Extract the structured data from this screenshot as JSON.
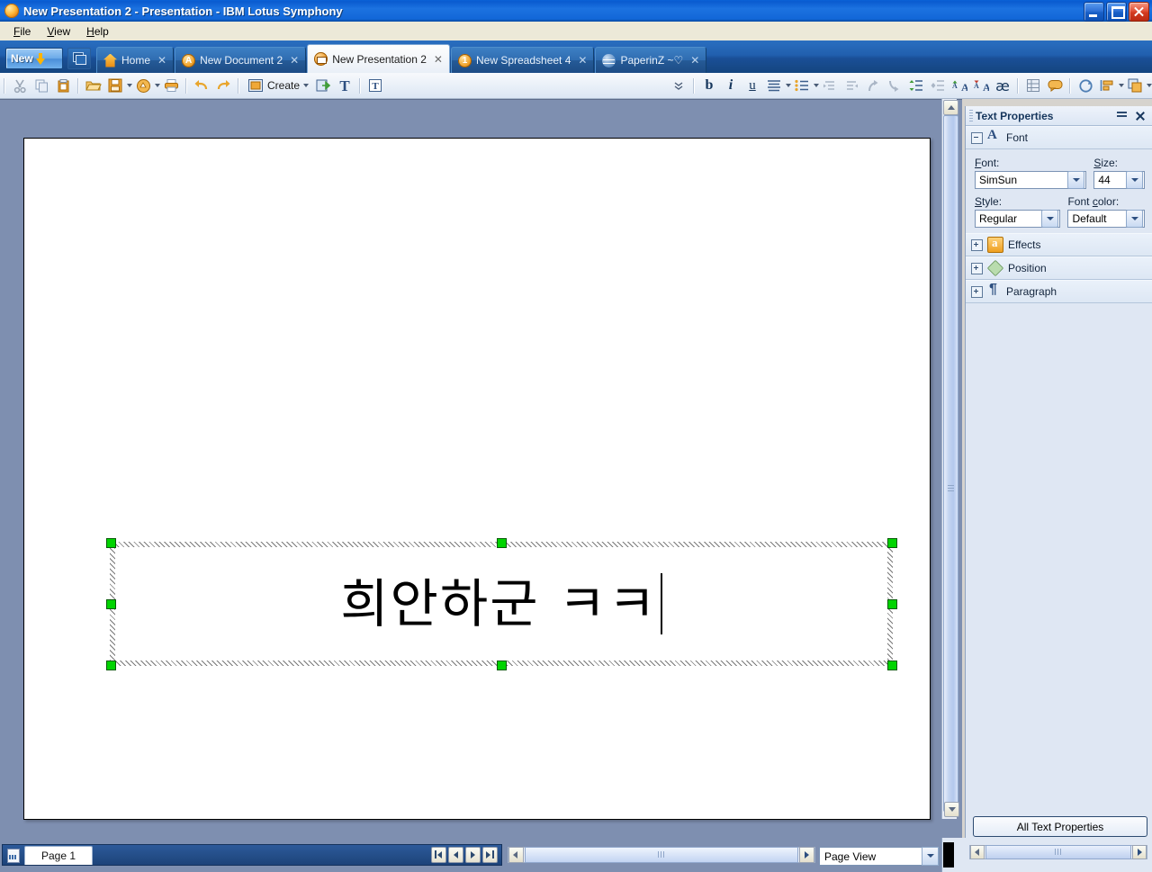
{
  "window": {
    "title": "New Presentation 2 - Presentation - IBM Lotus Symphony",
    "app_icon": "symphony-orb-icon",
    "buttons": {
      "minimize": "minimize-button",
      "restore": "restore-button",
      "close": "close-button"
    }
  },
  "menubar": {
    "items": [
      "File",
      "View",
      "Help"
    ]
  },
  "tabbar": {
    "new_button": {
      "label": "New",
      "icon": "download-arrow-icon"
    },
    "window_list_icon": "window-list-icon",
    "tabs": [
      {
        "label": "Home",
        "icon": "home-icon",
        "active": false,
        "closable": true
      },
      {
        "label": "New Document 2",
        "icon": "document-icon",
        "active": false,
        "closable": true
      },
      {
        "label": "New Presentation 2",
        "icon": "presentation-icon",
        "active": true,
        "closable": true
      },
      {
        "label": "New Spreadsheet 4",
        "icon": "spreadsheet-icon",
        "active": false,
        "closable": true
      },
      {
        "label": "PaperinZ ~♡",
        "icon": "web-page-icon",
        "active": false,
        "closable": true
      }
    ]
  },
  "toolbar": {
    "buttons": [
      "cut-icon",
      "copy-icon",
      "paste-icon",
      "open-icon",
      "save-icon",
      "new-style-icon",
      "print-icon",
      "undo-icon",
      "redo-icon",
      "create-icon",
      "insert-object-icon",
      "text-icon",
      "text-box-icon",
      "bold-icon",
      "italic-icon",
      "underline-icon",
      "align-icon",
      "bullets-icon",
      "demote-icon",
      "promote-icon",
      "move-up-icon",
      "move-down-icon",
      "line-spacing-increase-icon",
      "line-spacing-decrease-icon",
      "increase-font-icon",
      "decrease-font-icon",
      "special-character-icon",
      "table-icon",
      "callout-icon",
      "rotate-icon",
      "align-objects-icon",
      "arrange-icon"
    ],
    "create_label": "Create",
    "overflow_label": "toolbar-overflow"
  },
  "slide": {
    "textbox": {
      "text": "희안하군 ㅋㅋ",
      "cursor_visible": true,
      "selected": true,
      "handles": 8
    }
  },
  "panel": {
    "title": "Text Properties",
    "menu_icon": "panel-menu-icon",
    "close_icon": "panel-close-icon",
    "sections": [
      {
        "name": "Font",
        "icon": "font-A-icon",
        "expanded": true
      },
      {
        "name": "Effects",
        "icon": "effects-icon",
        "expanded": false
      },
      {
        "name": "Position",
        "icon": "position-icon",
        "expanded": false
      },
      {
        "name": "Paragraph",
        "icon": "paragraph-icon",
        "expanded": false
      }
    ],
    "font_section": {
      "font_label": "Font:",
      "font_value": "SimSun",
      "size_label": "Size:",
      "size_value": "44",
      "style_label": "Style:",
      "style_value": "Regular",
      "color_label": "Font color:",
      "color_value": "Default"
    },
    "all_properties_button": "All Text Properties"
  },
  "statusbar": {
    "page_tab": "Page 1",
    "page_tab_icon": "slide-sorter-icon",
    "nav_buttons": [
      "first-page-button",
      "previous-page-button",
      "next-page-button",
      "last-page-button"
    ],
    "view_mode": "Page View"
  },
  "colors": {
    "titlebar_blue": "#1267d8",
    "tabbar_blue": "#215fae",
    "canvas_gray": "#7e8fb0",
    "panel_bg": "#dfe7f3",
    "handle_green": "#00d400",
    "accent_orange": "#ef9f21"
  }
}
